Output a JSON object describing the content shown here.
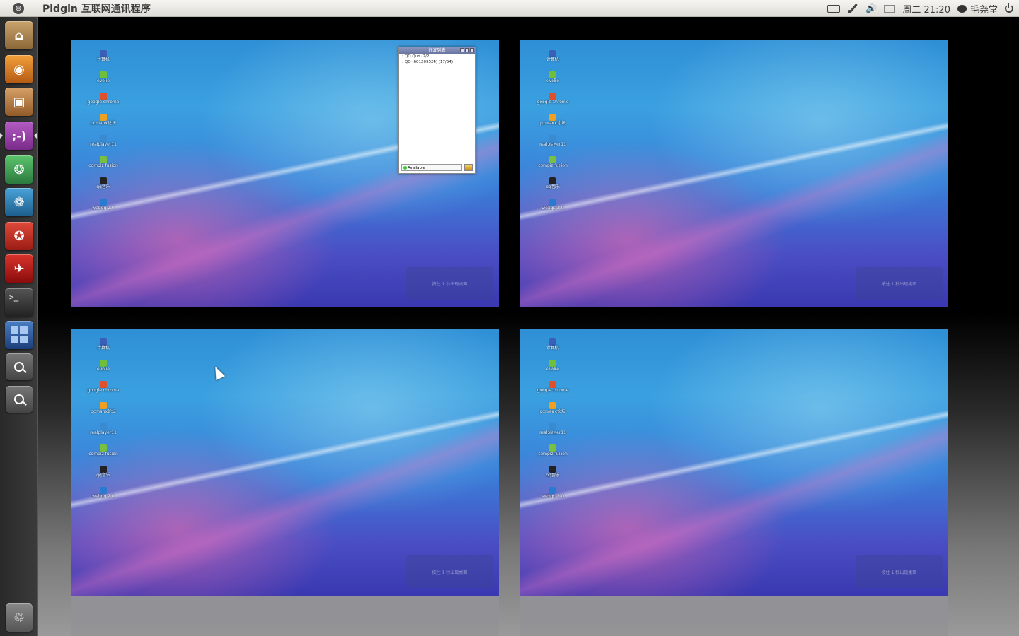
{
  "top_panel": {
    "app_title": "Pidgin 互联网通讯程序",
    "clock": "周二 21:20",
    "user": "毛尧堂"
  },
  "launcher": {
    "items": [
      "home-folder",
      "firefox",
      "software-center",
      "pidgin",
      "chat-client",
      "swirl-app",
      "red-app",
      "acrobat-reader",
      "terminal",
      "workspace-switcher",
      "zoom-in",
      "zoom-out",
      "trash"
    ],
    "pidgin_glyph": ";-)"
  },
  "workspaces": {
    "desktop_icons": [
      {
        "label": "计算机",
        "color": "#3a5fb8"
      },
      {
        "label": "evolie",
        "color": "#6fbf3a"
      },
      {
        "label": "google chrome",
        "color": "#e0502a"
      },
      {
        "label": "pcmanx论坛",
        "color": "#f0a020"
      },
      {
        "label": "realplayer11",
        "color": "#3a8ad0"
      },
      {
        "label": "compiz fusion",
        "color": "#7ac040"
      },
      {
        "label": "qq音乐",
        "color": "#222222"
      },
      {
        "label": "webqq 2.0",
        "color": "#2a7ad0"
      }
    ],
    "watermark": "按住 1 秒出现桌面"
  },
  "buddy_list": {
    "title": "好友列表",
    "groups": [
      "QQ Qun (2/2)",
      "QQ (601209524) (17/54)"
    ],
    "status": "Available"
  }
}
